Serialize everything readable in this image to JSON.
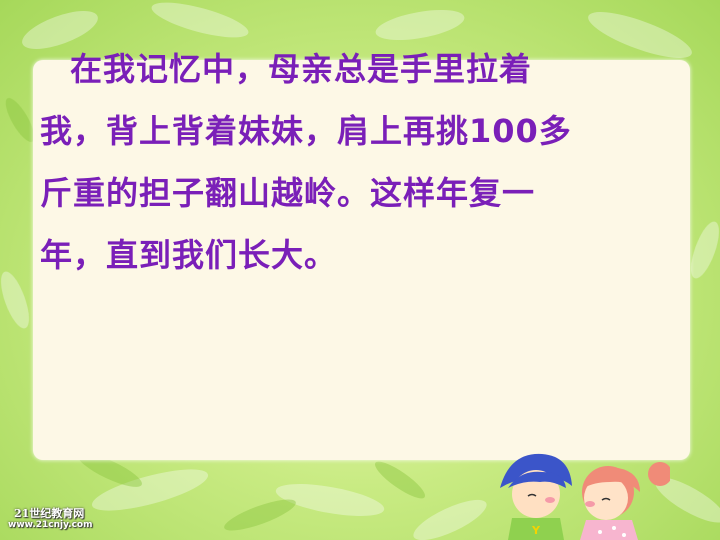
{
  "slide": {
    "lines": [
      "在我记忆中，母亲总是手里拉着",
      "我，背上背着妹妹，肩上再挑100多",
      "斤重的担子翻山越岭。这样年复一",
      "年，直到我们长大。"
    ],
    "text_color": "#7a1fb8"
  },
  "watermark": {
    "name": "21世纪教育网",
    "url": "www.21cnjy.com"
  },
  "illustration": {
    "icon": "kissing-kids-icon",
    "badge": "Y"
  },
  "colors": {
    "background": "#c9eb83",
    "panel": "#fdf8e6"
  }
}
